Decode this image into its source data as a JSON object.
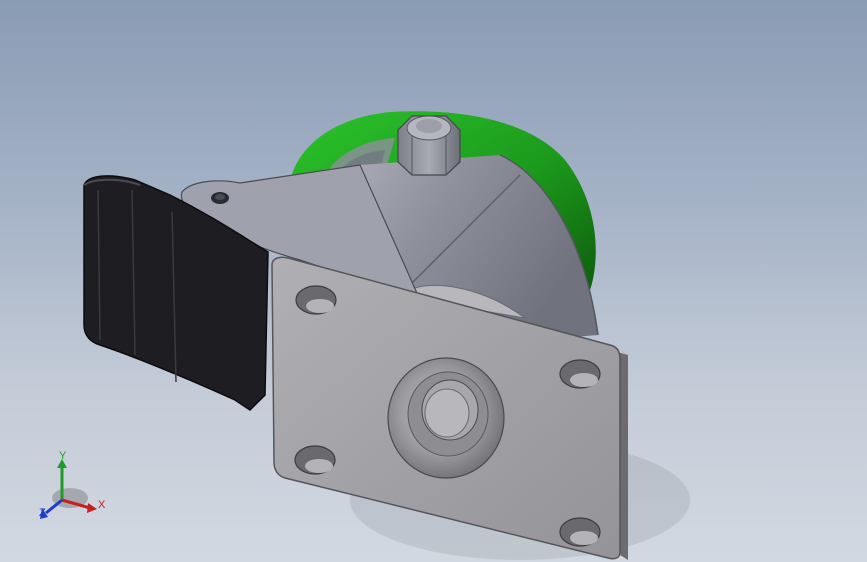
{
  "model": {
    "name": "caster-wheel-with-brake",
    "wheel_color": "#1fa01f",
    "body_color": "#8c8e9a",
    "plate_color": "#a2a2a6",
    "brake_pedal_color": "#1e1e22"
  },
  "triad": {
    "x_label": "X",
    "y_label": "Y",
    "z_label": "Z",
    "x_color": "#c81e1e",
    "y_color": "#1e9b2a",
    "z_color": "#1e3ccd"
  }
}
